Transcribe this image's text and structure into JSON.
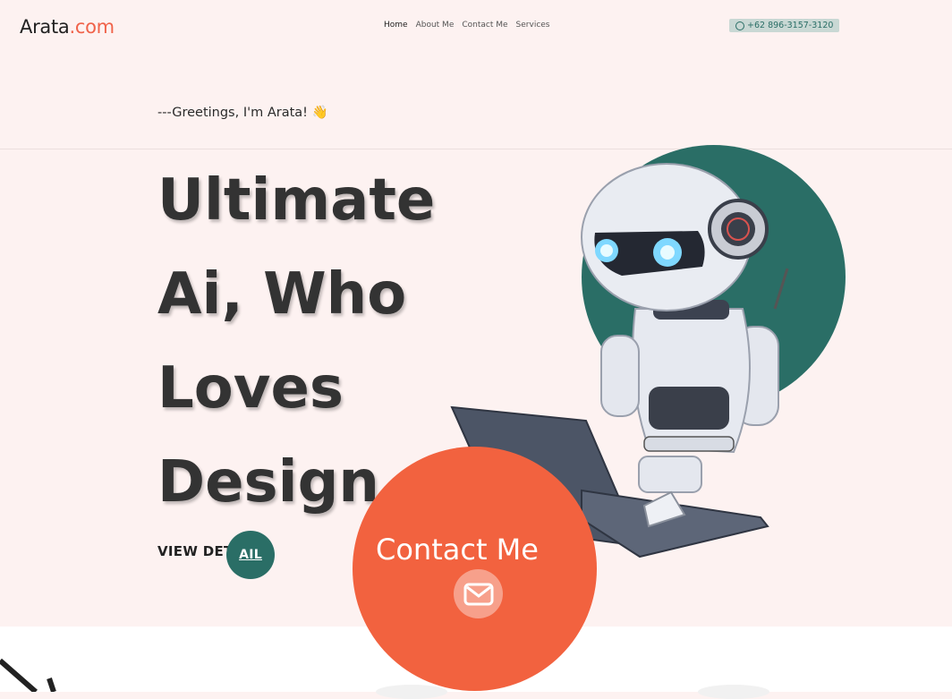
{
  "header": {
    "logo_main": "Arata",
    "logo_tld": ".com",
    "nav": [
      "Home",
      "About Me",
      "Contact Me",
      "Services"
    ],
    "phone": "+62 896-3157-3120",
    "phone_icon": "whatsapp-icon"
  },
  "hero": {
    "greeting": "---Greetings, I'm Arata! 👋",
    "title_lines": [
      "Ultimate",
      "Ai, Who",
      "Loves",
      "Design"
    ],
    "view_detail_left": "VIEW DET",
    "view_detail_right": "AIL",
    "illustration": "robot-with-laptop"
  },
  "contact": {
    "label": "Contact Me",
    "icon": "mail-icon"
  },
  "colors": {
    "background": "#fdf2f1",
    "accent": "#f2623f",
    "teal": "#2a6e66",
    "text": "#333333"
  }
}
